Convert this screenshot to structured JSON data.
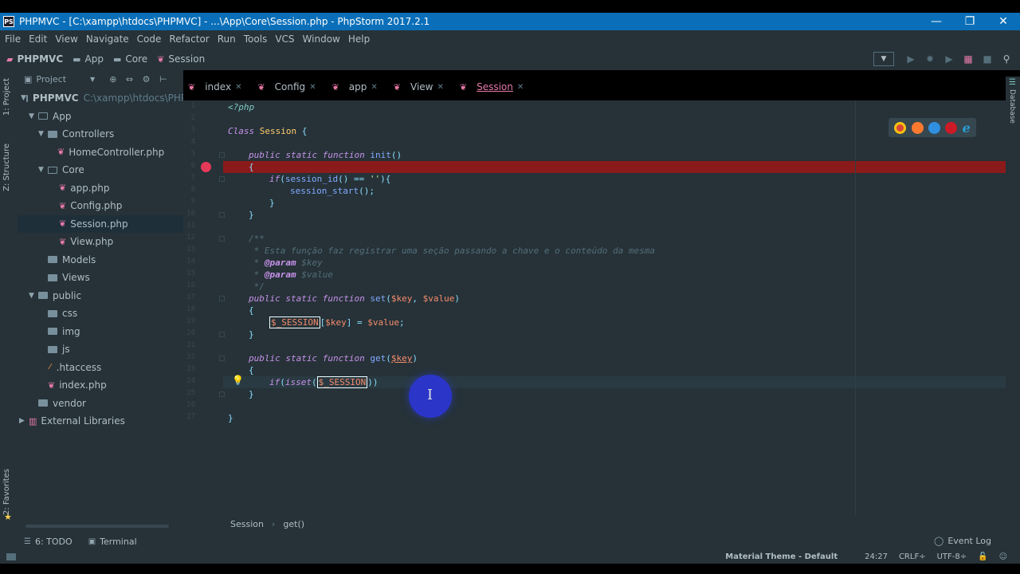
{
  "window": {
    "logo": "PS",
    "title": "PHPMVC - [C:\\xampp\\htdocs\\PHPMVC] - ...\\App\\Core\\Session.php - PhpStorm 2017.2.1",
    "minimize": "—",
    "restore": "❐",
    "close": "✕"
  },
  "menu": [
    "File",
    "Edit",
    "View",
    "Navigate",
    "Code",
    "Refactor",
    "Run",
    "Tools",
    "VCS",
    "Window",
    "Help"
  ],
  "breadcrumb": [
    "PHPMVC",
    "App",
    "Core",
    "Session"
  ],
  "left_tabs": {
    "project": "1: Project",
    "structure": "Z: Structure",
    "favorites": "2: Favorites"
  },
  "right_tabs": {
    "database": "Database"
  },
  "project_panel": {
    "header": "Project",
    "tools": "⊕ ⇔ ⚙ ⊢",
    "root": {
      "name": "PHPMVC",
      "path": "C:\\xampp\\htdocs\\PHPM"
    },
    "nodes": [
      {
        "label": "App"
      },
      {
        "label": "Controllers"
      },
      {
        "label": "HomeController.php"
      },
      {
        "label": "Core"
      },
      {
        "label": "app.php"
      },
      {
        "label": "Config.php"
      },
      {
        "label": "Session.php"
      },
      {
        "label": "View.php"
      },
      {
        "label": "Models"
      },
      {
        "label": "Views"
      },
      {
        "label": "public"
      },
      {
        "label": "css"
      },
      {
        "label": "img"
      },
      {
        "label": "js"
      },
      {
        "label": ".htaccess"
      },
      {
        "label": "index.php"
      },
      {
        "label": "vendor"
      },
      {
        "label": "External Libraries"
      }
    ]
  },
  "editor_tabs": [
    "index",
    "Config",
    "app",
    "View",
    "Session"
  ],
  "active_tab": "Session",
  "line_numbers": [
    "1",
    "2",
    "3",
    "4",
    "5",
    "6",
    "7",
    "8",
    "9",
    "10",
    "11",
    "12",
    "13",
    "14",
    "15",
    "16",
    "17",
    "18",
    "19",
    "20",
    "21",
    "22",
    "23",
    "24",
    "25",
    "26",
    "27"
  ],
  "code": {
    "l1": "<?php",
    "l3a": "Class",
    "l3b": "Session",
    "l3c": "{",
    "l5a": "public static function",
    "l5b": "init",
    "l5c": "()",
    "l6": "{",
    "l7a": "if",
    "l7b": "(",
    "l7c": "session_id",
    "l7d": "() ==",
    "l7e": "''",
    "l7f": "){",
    "l8a": "session_start",
    "l8b": "();",
    "l9": "}",
    "l10": "}",
    "l12": "/**",
    "l13": " * Esta função faz registrar uma seção passando a chave e o conteúdo da mesma",
    "l14a": " * ",
    "l14b": "@param",
    "l14c": " $key",
    "l15a": " * ",
    "l15b": "@param",
    "l15c": " $value",
    "l16": " */",
    "l17a": "public static function",
    "l17b": "set",
    "l17c": "(",
    "l17d": "$key",
    "l17e": ", ",
    "l17f": "$value",
    "l17g": ")",
    "l18": "{",
    "l19a": "$_SESSION",
    "l19b": "[",
    "l19c": "$key",
    "l19d": "] = ",
    "l19e": "$value",
    "l19f": ";",
    "l20": "}",
    "l22a": "public static function",
    "l22b": "get",
    "l22c": "(",
    "l22d": "$key",
    "l22e": ")",
    "l23": "{",
    "l24a": "if",
    "l24b": "(",
    "l24c": "isset",
    "l24d": "(",
    "l24e": "$_SESSION",
    "l24f": "))",
    "l25": "}",
    "l27": "}"
  },
  "editor_breadcrumb": [
    "Session",
    "get()"
  ],
  "bottom_tabs": {
    "todo": "6: TODO",
    "terminal": "Terminal",
    "event_log": "Event Log"
  },
  "status": {
    "theme": "Material Theme - Default",
    "position": "24:27",
    "line_sep": "CRLF÷",
    "encoding": "UTF-8÷"
  },
  "colors": {
    "accent": "#80cbc4",
    "breakpoint": "#e53959",
    "breakpoint_line": "#8b1a1a",
    "titlebar": "#0a6fb8",
    "background": "#263238"
  },
  "icons": {
    "chrome": "#d9453b",
    "firefox": "#ff7a2f",
    "safari": "#2f8fe0",
    "opera": "#cc1a26",
    "ie": "#2a9fd6"
  }
}
